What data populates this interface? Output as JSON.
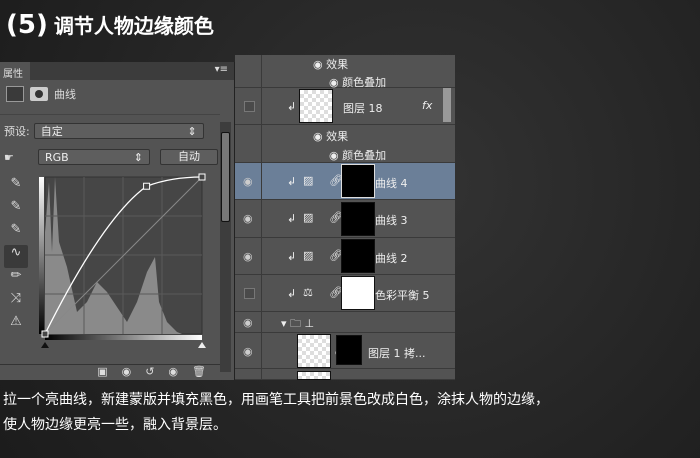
{
  "title": {
    "step": "(5)",
    "text": "调节人物边缘颜色"
  },
  "properties": {
    "tab": "属性",
    "menu_icon": "panel-menu-icon",
    "type": "曲线",
    "preset_label": "预设:",
    "preset_value": "自定",
    "channel": "RGB",
    "auto_label": "自动"
  },
  "curve": {
    "points": [
      [
        0,
        0
      ],
      [
        165,
        240
      ],
      [
        255,
        255
      ]
    ],
    "range": [
      0,
      255
    ]
  },
  "layers": [
    {
      "name": "效果",
      "kind": "effect"
    },
    {
      "name": "颜色叠加",
      "kind": "effect-item"
    },
    {
      "name": "图层",
      "num": "18",
      "visible": false,
      "fx": "fx"
    },
    {
      "name": "效果",
      "kind": "effect"
    },
    {
      "name": "颜色叠加",
      "kind": "effect-item"
    },
    {
      "name": "曲线",
      "num": "4",
      "visible": true,
      "selected": true
    },
    {
      "name": "曲线",
      "num": "3",
      "visible": true
    },
    {
      "name": "曲线",
      "num": "2",
      "visible": true
    },
    {
      "name": "色彩平衡",
      "num": "5",
      "visible": false
    },
    {
      "name": "图层",
      "num": "1 拷...",
      "visible": true
    }
  ],
  "caption": [
    "拉一个亮曲线，新建蒙版并填充黑色，用画笔工具把前景色改成白色，涂抹人物的边缘，",
    "使人物边缘更亮一些，融入背景层。"
  ]
}
